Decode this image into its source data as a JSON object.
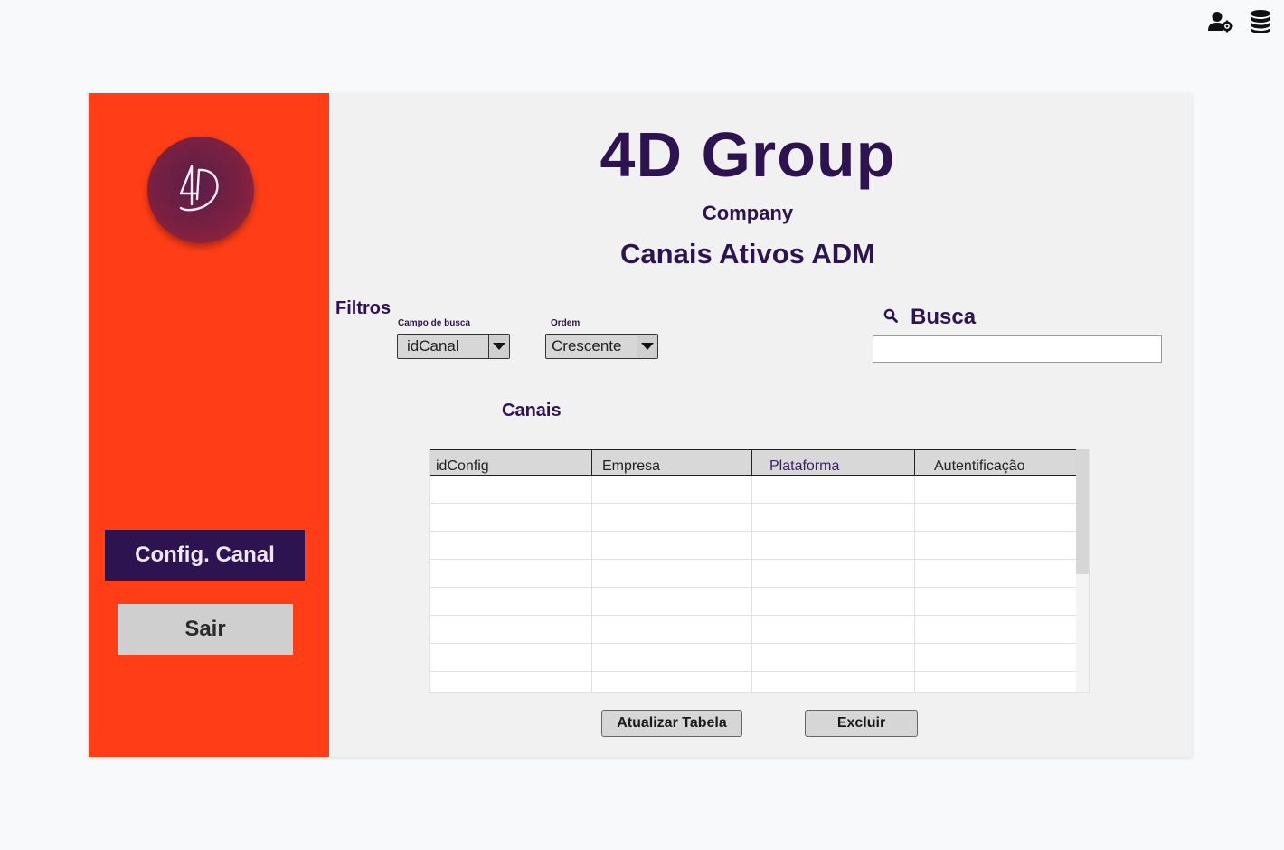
{
  "topbar": {
    "icons": [
      {
        "name": "user-settings-icon"
      },
      {
        "name": "database-icon"
      }
    ]
  },
  "sidebar": {
    "logo_text": "4D",
    "config_button": "Config. Canal",
    "sair_button": "Sair"
  },
  "header": {
    "title": "4D Group",
    "subtitle": "Company",
    "page_title": "Canais Ativos ADM"
  },
  "filters": {
    "label": "Filtros",
    "campo_label": "Campo de busca",
    "campo_value": "idCanal",
    "ordem_label": "Ordem",
    "ordem_value": "Crescente"
  },
  "search": {
    "label": "Busca",
    "value": ""
  },
  "table": {
    "title": "Canais",
    "columns": [
      "idConfig",
      "Empresa",
      "Plataforma",
      "Autentificação"
    ],
    "rows": [
      [
        "",
        "",
        "",
        ""
      ],
      [
        "",
        "",
        "",
        ""
      ],
      [
        "",
        "",
        "",
        ""
      ],
      [
        "",
        "",
        "",
        ""
      ],
      [
        "",
        "",
        "",
        ""
      ],
      [
        "",
        "",
        "",
        ""
      ],
      [
        "",
        "",
        "",
        ""
      ],
      [
        "",
        "",
        "",
        ""
      ]
    ]
  },
  "actions": {
    "refresh": "Atualizar Tabela",
    "delete": "Excluir"
  },
  "colors": {
    "sidebar": "#ff3e17",
    "brand": "#2d1451",
    "panel": "#f1f1f1"
  }
}
